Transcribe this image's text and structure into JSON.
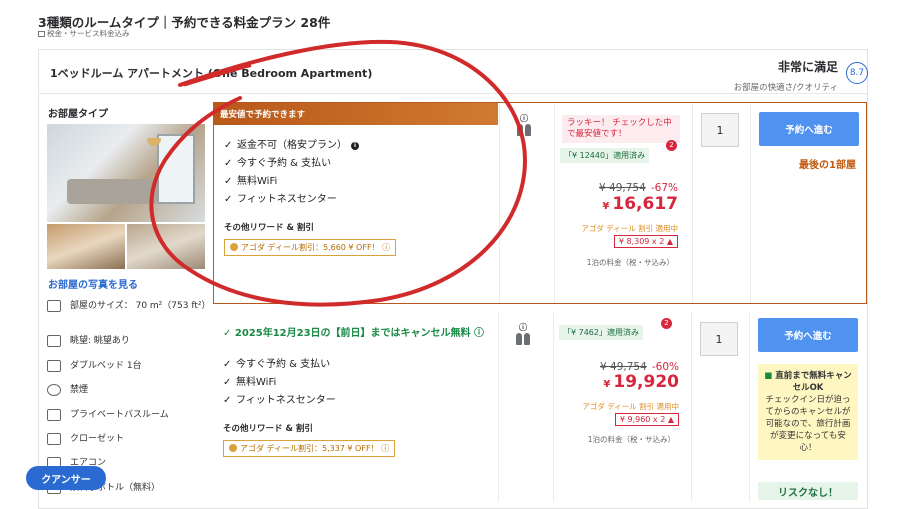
{
  "header": {
    "title": "3種類のルームタイプ｜予約できる料金プラン 28件",
    "note": "税金・サービス料金込み"
  },
  "room": {
    "name": "1ベッドルーム アパートメント (One Bedroom Apartment)",
    "rating_label": "非常に満足",
    "rating_sub": "お部屋の快適さ/クオリティ",
    "rating_score": "8.7"
  },
  "sidebar": {
    "title": "お部屋タイプ",
    "photo_link": "お部屋の写真を見る",
    "amenities": [
      {
        "icon": "house-icon",
        "label": "部屋のサイズ： 70 m²（753 ft²）"
      },
      {
        "icon": "window-icon",
        "label": "眺望: 眺望あり"
      },
      {
        "icon": "bed-icon",
        "label": "ダブルベッド 1台"
      },
      {
        "icon": "no-smoking-icon",
        "label": "禁煙"
      },
      {
        "icon": "shower-icon",
        "label": "プライベートバスルーム"
      },
      {
        "icon": "closet-icon",
        "label": "クローゼット"
      },
      {
        "icon": "aircon-icon",
        "label": "エアコン"
      },
      {
        "icon": "water-bottle-icon",
        "label": "飲料水ボトル（無料）"
      }
    ]
  },
  "offers": [
    {
      "banner": "最安値で予約できます",
      "features": [
        "返金不可（格安プラン）",
        "今すぐ予約 & 支払い",
        "無料WiFi",
        "フィットネスセンター"
      ],
      "reward_title": "その他リワード & 割引",
      "agoda_deal": "アゴダ ディール割引：5,660 ¥ OFF！ ⓘ",
      "lucky": "ラッキー！ チェックした中で最安値です！",
      "coupon": "「¥ 12440」適用済み",
      "coupon_count": "2",
      "original_price": "¥ 49,754",
      "discount": "-67%",
      "price_yen": "¥",
      "price": "16,617",
      "deal_applied": "アゴダ ディール 割引 適用中",
      "split": "¥ 8,309 x 2",
      "per_night": "1泊の料金（税・サ込み）",
      "qty": "1",
      "button": "予約へ進む",
      "stock": "最後の1部屋"
    },
    {
      "cancel": "2025年12月23日の【前日】まではキャンセル無料",
      "features": [
        "今すぐ予約 & 支払い",
        "無料WiFi",
        "フィットネスセンター"
      ],
      "reward_title": "その他リワード & 割引",
      "agoda_deal": "アゴダ ディール割引：5,337 ¥ OFF！ ⓘ",
      "coupon": "「¥ 7462」適用済み",
      "coupon_count": "2",
      "original_price": "¥ 49,754",
      "discount": "-60%",
      "price_yen": "¥",
      "price": "19,920",
      "deal_applied": "アゴダ ディール 割引 適用中",
      "split": "¥ 9,960 x 2",
      "per_night": "1泊の料金（税・サ込み）",
      "qty": "1",
      "button": "予約へ進む",
      "free_cancel_title": "直前まで無料キャンセルOK",
      "free_cancel_body": "チェックイン日が迫ってからのキャンセルが可能なので、旅行計画が変更になっても安心！",
      "no_risk": "リスクなし！"
    }
  ],
  "concierge": "クアンサー",
  "colors": {
    "accent": "#4f92f0",
    "highlight_border": "#b8581a",
    "price_red": "#d7263d",
    "scribble": "#d12a2a"
  }
}
